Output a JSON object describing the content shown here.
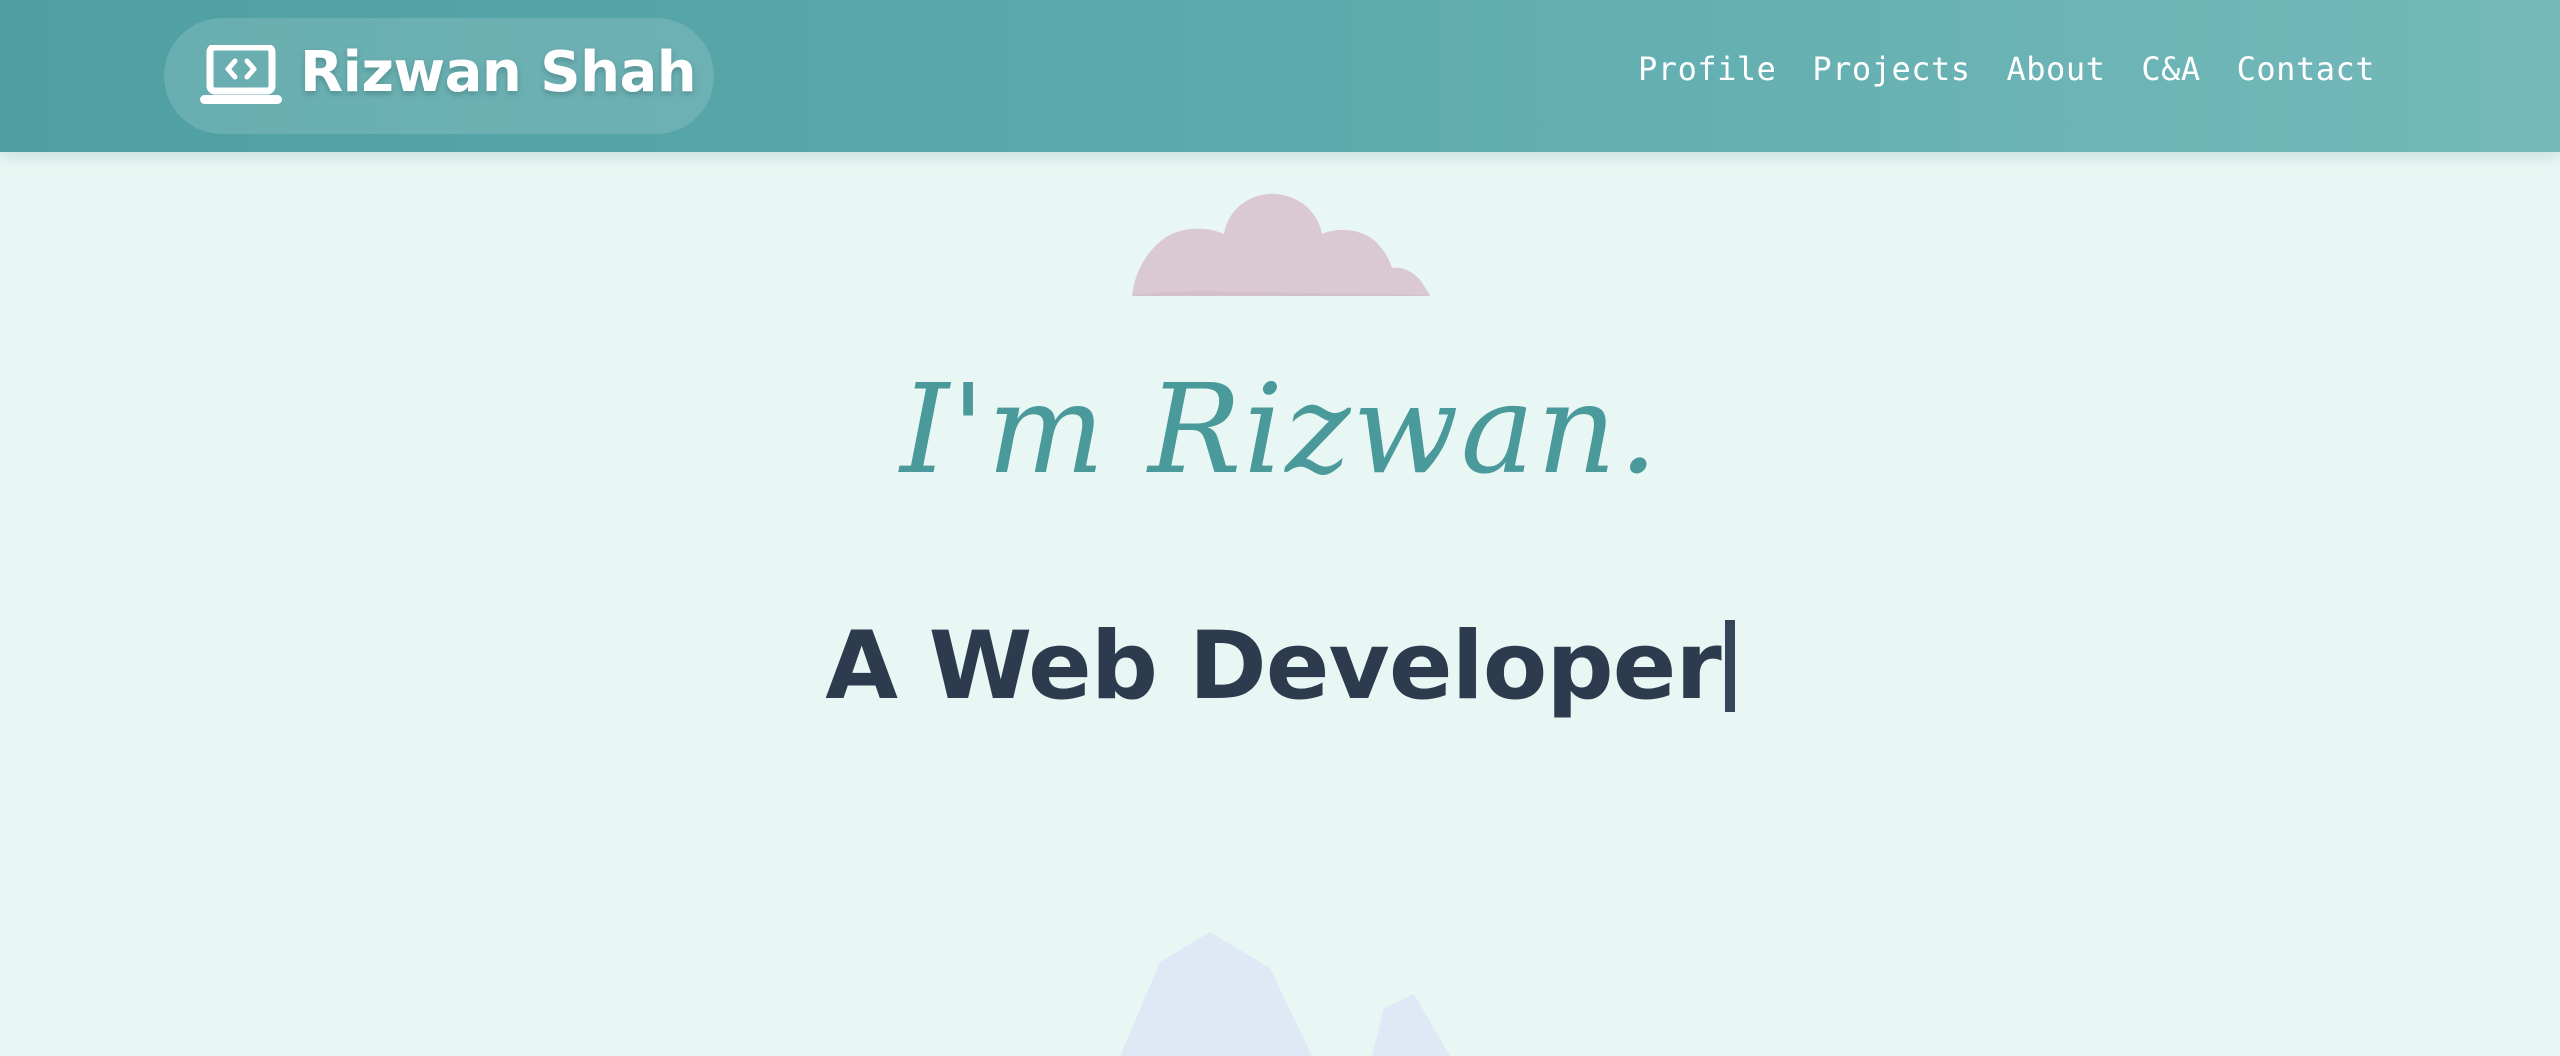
{
  "header": {
    "brand_name": "Rizwan Shah",
    "brand_icon": "laptop-code-icon",
    "nav_items": [
      {
        "label": "Profile"
      },
      {
        "label": "Projects"
      },
      {
        "label": "About"
      },
      {
        "label": "C&A"
      },
      {
        "label": "Contact"
      }
    ]
  },
  "hero": {
    "greeting": "I'm Rizwan.",
    "role": "A Web Developer"
  },
  "colors": {
    "nav_gradient_start": "#4f9fa2",
    "nav_gradient_end": "#75b9ba",
    "page_background": "#e8f7f3",
    "script_text": "#4a999b",
    "heading_text": "#2d3b4e",
    "cloud": "#dbc9d1",
    "mountains": "#dfe9f5"
  }
}
